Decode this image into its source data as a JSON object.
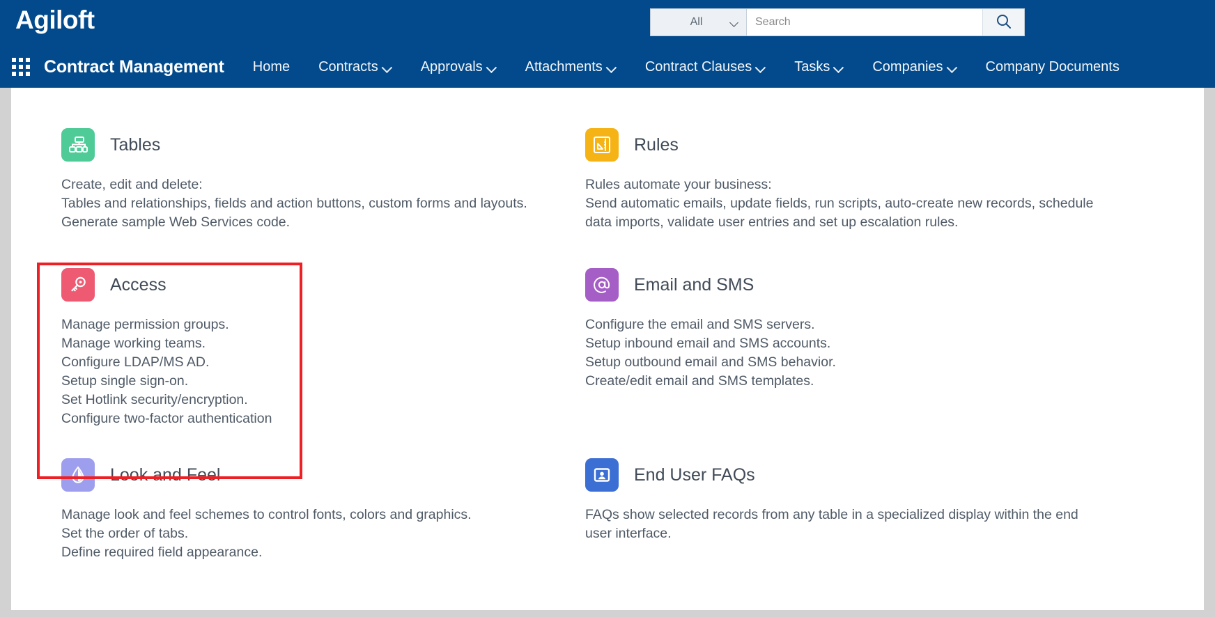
{
  "header": {
    "logo": "Agiloft",
    "app_title": "Contract Management",
    "grid_icon": "app-grid-icon",
    "search": {
      "scope_selected": "All",
      "scope_options": [
        "All"
      ],
      "placeholder": "Search",
      "value": "",
      "button_icon": "search-icon"
    },
    "nav": [
      {
        "label": "Home",
        "has_dropdown": false
      },
      {
        "label": "Contracts",
        "has_dropdown": true
      },
      {
        "label": "Approvals",
        "has_dropdown": true
      },
      {
        "label": "Attachments",
        "has_dropdown": true
      },
      {
        "label": "Contract Clauses",
        "has_dropdown": true
      },
      {
        "label": "Tasks",
        "has_dropdown": true
      },
      {
        "label": "Companies",
        "has_dropdown": true
      },
      {
        "label": "Company Documents",
        "has_dropdown": false
      }
    ]
  },
  "highlight": {
    "color": "#ee2024",
    "target": "Access"
  },
  "cards": [
    {
      "title": "Tables",
      "icon": "sitemap-icon",
      "icon_color": "#4ECB97",
      "lines": [
        "Create, edit and delete:",
        "Tables and relationships, fields and action buttons, custom forms and layouts.",
        "Generate sample Web Services code."
      ]
    },
    {
      "title": "Rules",
      "icon": "ruler-chart-icon",
      "icon_color": "#F6B316",
      "lines": [
        "Rules automate your business:",
        "Send automatic emails, update fields, run scripts, auto-create new records, schedule",
        "data imports, validate user entries and set up escalation rules."
      ]
    },
    {
      "title": "Access",
      "icon": "key-icon",
      "icon_color": "#EE5A72",
      "lines": [
        "Manage permission groups.",
        "Manage working teams.",
        "Configure LDAP/MS AD.",
        "Setup single sign-on.",
        "Set Hotlink security/encryption.",
        "Configure two-factor authentication"
      ]
    },
    {
      "title": "Email and SMS",
      "icon": "at-sign-icon",
      "icon_color": "#A45EC6",
      "lines": [
        "Configure the email and SMS servers.",
        "Setup inbound email and SMS accounts.",
        "Setup outbound email and SMS behavior.",
        "Create/edit email and SMS templates."
      ]
    },
    {
      "title": "Look and Feel",
      "icon": "water-drop-icon",
      "icon_color": "#9E9EEE",
      "lines": [
        "Manage look and feel schemes to control fonts, colors and graphics.",
        "Set the order of tabs.",
        "Define required field appearance."
      ]
    },
    {
      "title": "End User FAQs",
      "icon": "user-frame-icon",
      "icon_color": "#3B6FD4",
      "lines": [
        "FAQs show selected records from any table in a specialized display within the end",
        "user interface."
      ]
    }
  ],
  "colors": {
    "header_blue": "#024a8c",
    "page_bg": "#ffffff",
    "frame_gray": "#d2d2d2",
    "text": "#4f5a66"
  }
}
